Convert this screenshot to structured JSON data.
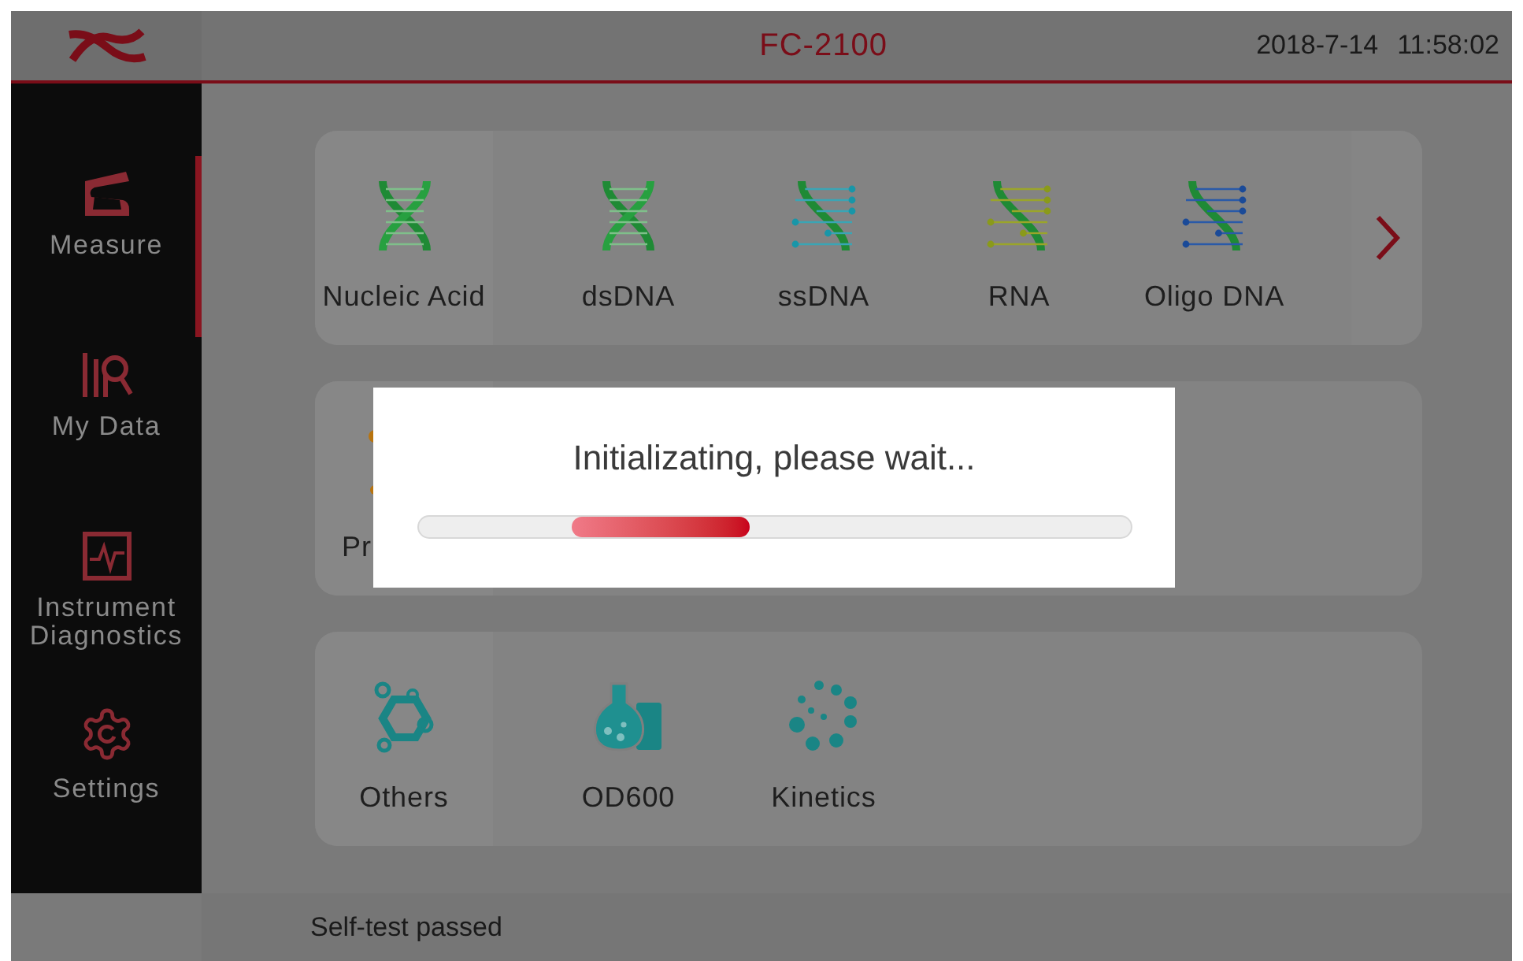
{
  "header": {
    "title": "FC-2100",
    "date": "2018-7-14",
    "time": "11:58:02"
  },
  "sidebar": {
    "items": [
      {
        "label": "Measure",
        "kind": "measure",
        "selected": true
      },
      {
        "label": "My Data",
        "kind": "data",
        "selected": false
      },
      {
        "label": "Instrument Diagnostics",
        "kind": "diagnostics",
        "selected": false
      },
      {
        "label": "Settings",
        "kind": "settings",
        "selected": false
      }
    ]
  },
  "cards": [
    {
      "has_next": true,
      "items": [
        {
          "label": "Nucleic Acid",
          "kind": "dna"
        },
        {
          "label": "dsDNA",
          "kind": "dna"
        },
        {
          "label": "ssDNA",
          "kind": "ssdna"
        },
        {
          "label": "RNA",
          "kind": "rna"
        },
        {
          "label": "Oligo DNA",
          "kind": "oligo"
        }
      ]
    },
    {
      "has_next": false,
      "items": [
        {
          "label": "Pr",
          "kind": "protein"
        }
      ]
    },
    {
      "has_next": false,
      "items": [
        {
          "label": "Others",
          "kind": "molecule"
        },
        {
          "label": "OD600",
          "kind": "flask"
        },
        {
          "label": "Kinetics",
          "kind": "dots"
        }
      ]
    }
  ],
  "dialog": {
    "message": "Initializating, please wait...",
    "level": 0.25
  },
  "status_bar": {
    "message": "Self-test passed"
  }
}
